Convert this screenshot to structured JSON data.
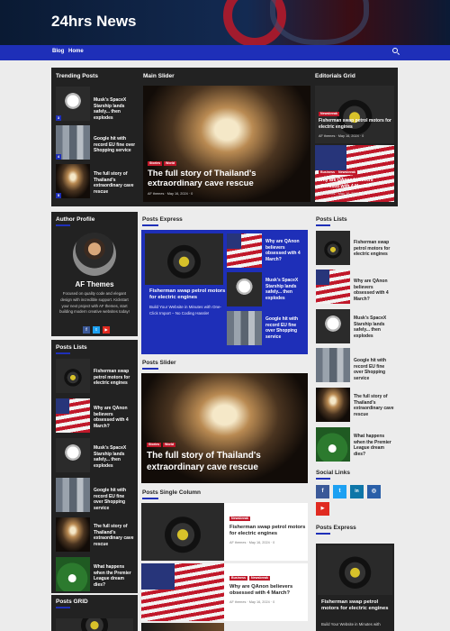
{
  "site": {
    "title": "24hrs News"
  },
  "nav": {
    "blog": "Blog",
    "home": "Home"
  },
  "trending": {
    "title": "Trending Posts",
    "items": [
      {
        "num": "3",
        "text": "Musk's SpaceX Starship lands safely... then explodes"
      },
      {
        "num": "4",
        "text": "Google hit with record EU fine over Shopping service"
      },
      {
        "num": "5",
        "text": "The full story of Thailand's extraordinary cave rescue"
      }
    ]
  },
  "main_slider": {
    "title": "Main Slider",
    "tags": [
      "Stories",
      "World"
    ],
    "headline": "The full story of Thailand's extraordinary cave rescue",
    "author": "AF themes",
    "date": "May 16, 2024",
    "comments": "0"
  },
  "editorials": {
    "title": "Editorials Grid",
    "items": [
      {
        "tags": [
          "Newsbreak"
        ],
        "text": "Fisherman swap petrol motors for electric engines",
        "author": "AF themes",
        "date": "May 16, 2024",
        "comments": "0"
      },
      {
        "tags": [
          "Business",
          "Newsbreak"
        ],
        "text": "Why are QAnon believers obsessed with 4 March?",
        "author": "AF themes",
        "date": "May 16, 2024",
        "comments": "0"
      }
    ]
  },
  "author_profile": {
    "title": "Author Profile",
    "name": "AF Themes",
    "bio": "Focused on quality code and elegant design with incredible support. Kickstart your next project with AF themes, start building modern creative websites today!",
    "social": [
      "f",
      "t",
      "▶"
    ]
  },
  "left_posts_lists": {
    "title": "Posts Lists",
    "items": [
      "Fisherman swap petrol motors for electric engines",
      "Why are QAnon believers obsessed with 4 March?",
      "Musk's SpaceX Starship lands safely... then explodes",
      "Google hit with record EU fine over Shopping service",
      "The full story of Thailand's extraordinary cave rescue",
      "What happens when the Premier League dream dies?"
    ]
  },
  "posts_grid": {
    "title": "Posts GRID"
  },
  "posts_express": {
    "title": "Posts Express",
    "feature_title": "Fisherman swap petrol motors for electric engines",
    "feature_excerpt": "Build Your Website in Minutes with One-Click Import – No Coding Hassle!",
    "items": [
      "Why are QAnon believers obsessed with 4 March?",
      "Musk's SpaceX Starship lands safely... then explodes",
      "Google hit with record EU fine over Shopping service"
    ]
  },
  "posts_slider": {
    "title": "Posts Slider",
    "tags": [
      "Stories",
      "World"
    ],
    "headline": "The full story of Thailand's extraordinary cave rescue"
  },
  "single_column": {
    "title": "Posts Single Column",
    "items": [
      {
        "tags": [
          "Newsbreak"
        ],
        "text": "Fisherman swap petrol motors for electric engines",
        "author": "AF themes",
        "date": "May 16, 2024",
        "comments": "0"
      },
      {
        "tags": [
          "Business",
          "Newsbreak"
        ],
        "text": "Why are QAnon believers obsessed with 4 March?",
        "author": "AF themes",
        "date": "May 16, 2024",
        "comments": "0"
      }
    ]
  },
  "right_posts_lists": {
    "title": "Posts Lists",
    "items": [
      "Fisherman swap petrol motors for electric engines",
      "Why are QAnon believers obsessed with 4 March?",
      "Musk's SpaceX Starship lands safely... then explodes",
      "Google hit with record EU fine over Shopping service",
      "The full story of Thailand's extraordinary cave rescue",
      "What happens when the Premier League dream dies?"
    ]
  },
  "social_links": {
    "title": "Social Links",
    "icons": [
      "f",
      "t",
      "in",
      "◎",
      "▶"
    ]
  },
  "right_express": {
    "title": "Posts Express",
    "feature_title": "Fisherman swap petrol motors for electric engines",
    "feature_excerpt": "Build Your Website in Minutes with"
  },
  "colors": {
    "accent": "#1e2fb8",
    "tag": "#c0182a",
    "dark_panel": "#222222"
  }
}
